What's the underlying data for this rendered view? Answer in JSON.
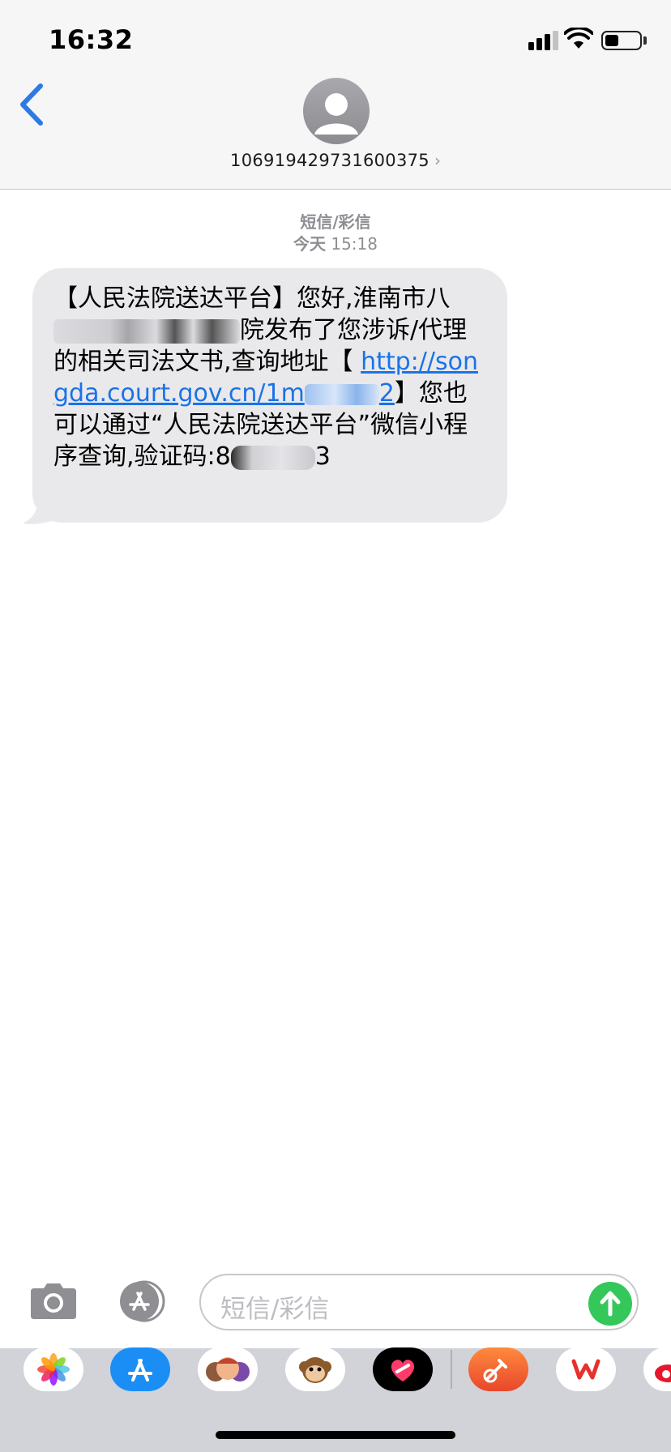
{
  "status_bar": {
    "time": "16:32",
    "signal_icon": "cellular-signal-icon",
    "wifi_icon": "wifi-icon",
    "battery_level": 0.4
  },
  "header": {
    "back_icon": "chevron-left-icon",
    "avatar_icon": "person-icon",
    "contact_number": "106919429731600375",
    "contact_chevron": "›"
  },
  "conversation": {
    "message_type": "短信/彩信",
    "day": "今天",
    "time": "15:18",
    "message": {
      "part1": "【人民法院送达平台】您好,淮南市",
      "part2_redacted_start": "八",
      "part3": "院发布了您涉诉/代理的相关司法文书,查询地址【 ",
      "link_start": "http://songda.court.gov.cn/",
      "link_partial": "1m",
      "link_end": "2",
      "part4": "】您也可以通过“人民法院送达平台”微信小程序查询,验证码:",
      "code_start": "8",
      "code_end": "3"
    }
  },
  "input_bar": {
    "camera_icon": "camera-icon",
    "apps_icon": "app-store-icon",
    "placeholder": "短信/彩信",
    "send_icon": "arrow-up-icon",
    "send_color": "#34c759"
  },
  "app_strip": {
    "apps": [
      {
        "name": "photos-app-icon"
      },
      {
        "name": "app-store-app-icon"
      },
      {
        "name": "memoji-app-icon"
      },
      {
        "name": "animoji-app-icon"
      },
      {
        "name": "digital-touch-app-icon"
      },
      {
        "name": "garageband-app-icon"
      },
      {
        "name": "wps-app-icon"
      },
      {
        "name": "weibo-app-icon"
      }
    ]
  },
  "colors": {
    "link": "#1a73e8",
    "bubble": "#e9e9eb",
    "header_bg": "#f6f6f6",
    "accent_blue": "#2c7be5"
  }
}
